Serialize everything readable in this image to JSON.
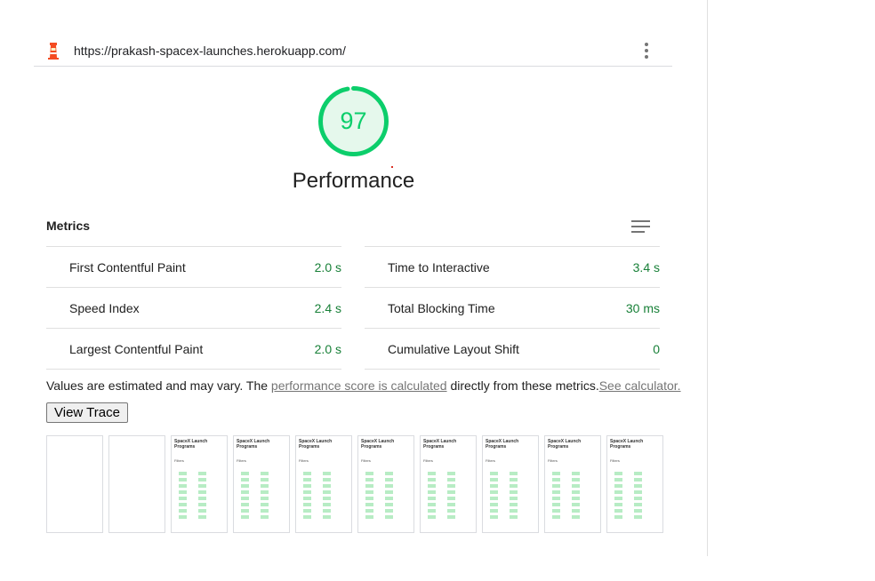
{
  "url_bar": {
    "url": "https://prakash-spacex-launches.herokuapp.com/"
  },
  "gauge": {
    "score": "97",
    "title": "Performance",
    "score_fraction": 0.97,
    "color": "#0cce6b"
  },
  "metrics": {
    "title": "Metrics",
    "left": [
      {
        "label": "First Contentful Paint",
        "value": "2.0 s"
      },
      {
        "label": "Speed Index",
        "value": "2.4 s"
      },
      {
        "label": "Largest Contentful Paint",
        "value": "2.0 s"
      }
    ],
    "right": [
      {
        "label": "Time to Interactive",
        "value": "3.4 s"
      },
      {
        "label": "Total Blocking Time",
        "value": "30 ms"
      },
      {
        "label": "Cumulative Layout Shift",
        "value": "0"
      }
    ]
  },
  "note": {
    "prefix": "Values are estimated and may vary. The ",
    "link1": "performance score is calculated",
    "middle": " directly from these metrics.",
    "link2": "See calculator."
  },
  "buttons": {
    "view_trace": "View Trace"
  },
  "filmstrip": {
    "frame_title": "SpaceX Launch Programs",
    "frame_subtitle": "Filters",
    "blank_frames": 2,
    "content_frames": 8
  },
  "colors": {
    "pass": "#188038",
    "gauge": "#0cce6b",
    "gauge_bg": "#e5f8ec"
  }
}
